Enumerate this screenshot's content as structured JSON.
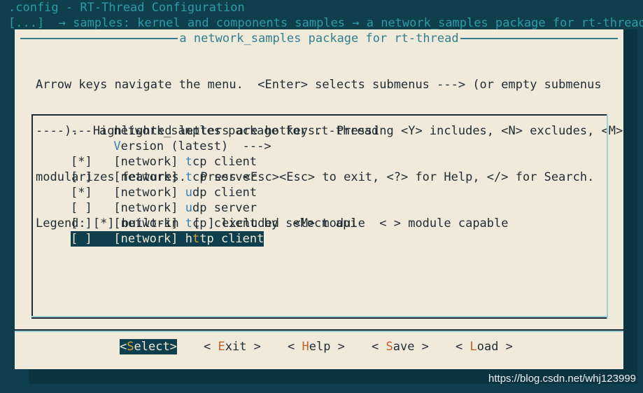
{
  "window": {
    "title_line": ".config - RT-Thread Configuration",
    "breadcrumb": "[...]  → samples: kernel and components samples → a network_samples package for rt-thread"
  },
  "dialog": {
    "title": "a network_samples package for rt-thread",
    "help_lines": [
      "Arrow keys navigate the menu.  <Enter> selects submenus ---> (or empty submenus",
      "----).  Highlighted letters are hotkeys.  Pressing <Y> includes, <N> excludes, <M>",
      "modularizes features.  Press <Esc><Esc> to exit, <?> for Help, </> for Search.",
      "Legend: [*] built-in  [ ] excluded  <M> module  < > module capable"
    ]
  },
  "menu": {
    "items": [
      {
        "pre": "--- a network_samples package for rt-thread",
        "hot": "",
        "post": ""
      },
      {
        "pre": "      ",
        "hot": "V",
        "post": "ersion (latest)  --->"
      },
      {
        "pre": "[*]   [network] ",
        "hot": "t",
        "post": "cp client"
      },
      {
        "pre": "[ ]   [network] ",
        "hot": "t",
        "post": "cp server"
      },
      {
        "pre": "[*]   [network] ",
        "hot": "u",
        "post": "dp client"
      },
      {
        "pre": "[ ]   [network] ",
        "hot": "u",
        "post": "dp server"
      },
      {
        "pre": "[ ]   [network] ",
        "hot": "t",
        "post": "cp client by select api"
      },
      {
        "pre": "[ ]   [network] h",
        "hot": "t",
        "post": "tp client"
      }
    ],
    "selected_index": 7
  },
  "buttons": [
    {
      "pre": "<",
      "hot": "S",
      "post": "elect>"
    },
    {
      "pre": "< ",
      "hot": "E",
      "post": "xit >"
    },
    {
      "pre": "< ",
      "hot": "H",
      "post": "elp >"
    },
    {
      "pre": "< ",
      "hot": "S",
      "post": "ave >"
    },
    {
      "pre": "< ",
      "hot": "L",
      "post": "oad >"
    }
  ],
  "watermark": "https://blog.csdn.net/whj123999",
  "colors": {
    "background": "#0f3f4c",
    "dialog": "#f0eadb",
    "hotkey_menu": "#3a7fb8",
    "hotkey_button": "#c25f2a",
    "selected_hotkey": "#d8a238"
  }
}
